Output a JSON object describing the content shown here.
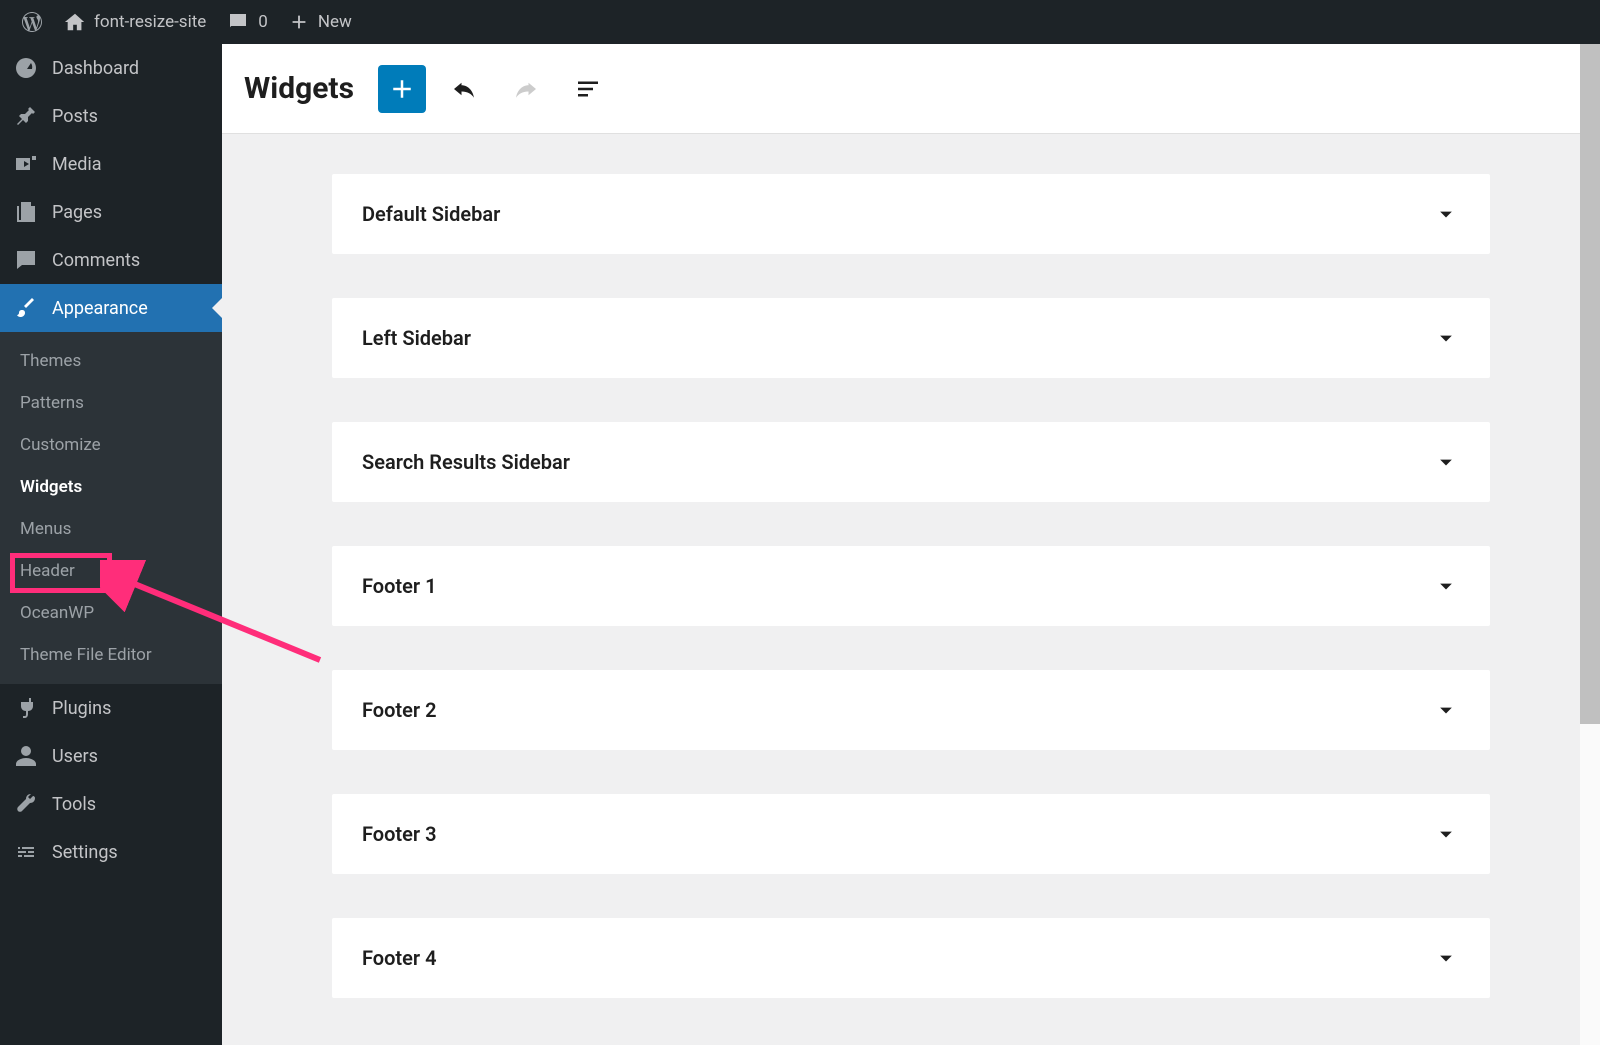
{
  "adminBar": {
    "siteName": "font-resize-site",
    "commentCount": "0",
    "newLabel": "New"
  },
  "sidebar": {
    "items": [
      {
        "label": "Dashboard",
        "icon": "dashboard"
      },
      {
        "label": "Posts",
        "icon": "pin"
      },
      {
        "label": "Media",
        "icon": "media"
      },
      {
        "label": "Pages",
        "icon": "pages"
      },
      {
        "label": "Comments",
        "icon": "comment"
      },
      {
        "label": "Appearance",
        "icon": "brush",
        "active": true
      },
      {
        "label": "Plugins",
        "icon": "plug"
      },
      {
        "label": "Users",
        "icon": "user"
      },
      {
        "label": "Tools",
        "icon": "wrench"
      },
      {
        "label": "Settings",
        "icon": "settings"
      }
    ],
    "submenu": {
      "items": [
        {
          "label": "Themes"
        },
        {
          "label": "Patterns"
        },
        {
          "label": "Customize"
        },
        {
          "label": "Widgets",
          "current": true
        },
        {
          "label": "Menus"
        },
        {
          "label": "Header"
        },
        {
          "label": "OceanWP"
        },
        {
          "label": "Theme File Editor"
        }
      ]
    }
  },
  "editor": {
    "title": "Widgets"
  },
  "widgetAreas": [
    {
      "title": "Default Sidebar"
    },
    {
      "title": "Left Sidebar"
    },
    {
      "title": "Search Results Sidebar"
    },
    {
      "title": "Footer 1"
    },
    {
      "title": "Footer 2"
    },
    {
      "title": "Footer 3"
    },
    {
      "title": "Footer 4"
    }
  ]
}
